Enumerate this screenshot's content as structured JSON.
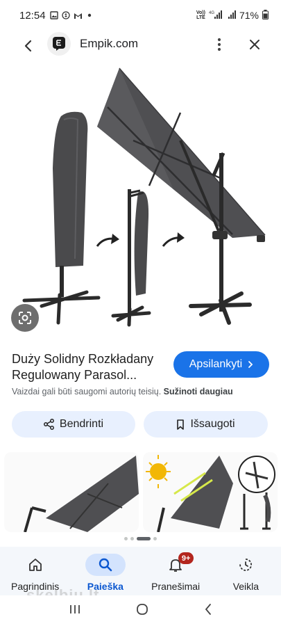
{
  "status_bar": {
    "time": "12:54",
    "network_top": "Vo))",
    "network_bottom": "LTE",
    "signal_label": "4G",
    "battery": "71%"
  },
  "top_bar": {
    "site": "Empik.com"
  },
  "product": {
    "title": "Duży Solidny Rozkładany Regulowany Parasol...",
    "visit_label": "Apsilankyti",
    "copyright_text": "Vaizdai gali būti saugomi autorių teisių.",
    "learn_more": "Sužinoti daugiau"
  },
  "actions": {
    "share_label": "Bendrinti",
    "save_label": "Išsaugoti"
  },
  "bottom_nav": {
    "items": [
      {
        "label": "Pagrindinis",
        "icon": "home-icon",
        "active": false
      },
      {
        "label": "Paieška",
        "icon": "search-icon",
        "active": true
      },
      {
        "label": "Pranešimai",
        "icon": "bell-icon",
        "active": false,
        "badge": "9+"
      },
      {
        "label": "Veikla",
        "icon": "activity-icon",
        "active": false
      }
    ]
  },
  "watermark": "skelbiu.lt",
  "colors": {
    "accent": "#1a73e8",
    "chip_bg": "#e8f0fe",
    "nav_active": "#0b57d0",
    "badge": "#b3261e",
    "umbrella": "#4a4a4c"
  }
}
